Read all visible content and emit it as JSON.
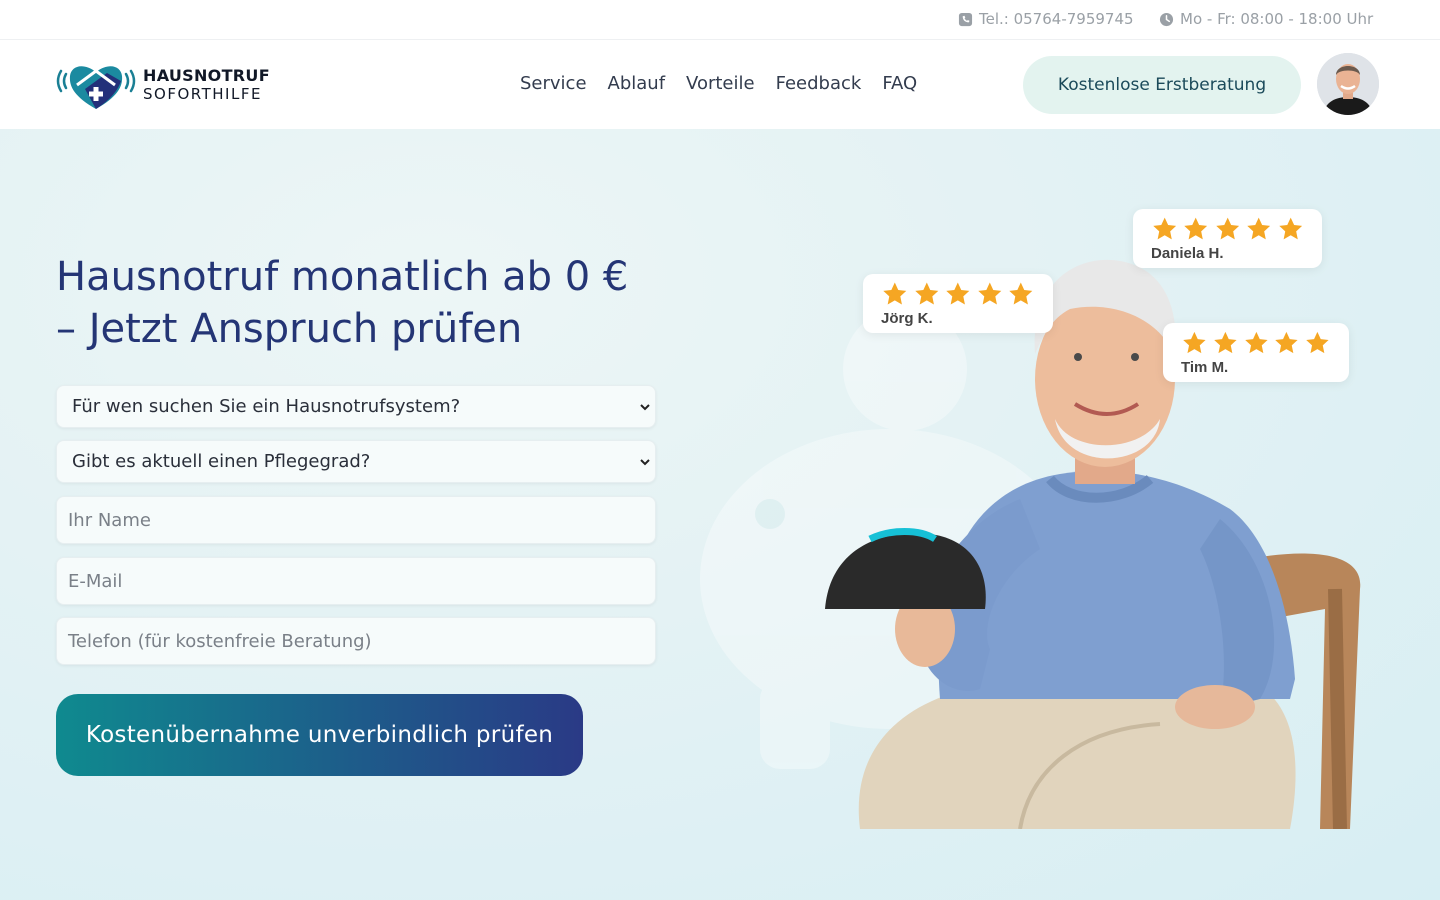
{
  "topbar": {
    "phone": "Tel.: 05764-7959745",
    "hours": "Mo - Fr: 08:00 - 18:00 Uhr"
  },
  "header": {
    "logo_line1": "HAUSNOTRUF",
    "logo_line2": "SOFORTHILFE",
    "nav": [
      "Service",
      "Ablauf",
      "Vorteile",
      "Feedback",
      "FAQ"
    ],
    "cta": "Kostenlose Erstberatung"
  },
  "hero": {
    "headline_line1": "Hausnotruf monatlich ab 0 €",
    "headline_line2": "– Jetzt Anspruch prüfen",
    "select_recipient": "Für wen suchen Sie ein Hausnotrufsystem?",
    "select_care_level": "Gibt es aktuell einen Pflegegrad?",
    "name_placeholder": "Ihr Name",
    "email_placeholder": "E-Mail",
    "phone_placeholder": "Telefon (für kostenfreie Beratung)",
    "submit": "Kostenübernahme unverbindlich prüfen"
  },
  "reviews": [
    {
      "name": "Daniela H.",
      "stars": 5
    },
    {
      "name": "Jörg K.",
      "stars": 5
    },
    {
      "name": "Tim M.",
      "stars": 5
    }
  ],
  "colors": {
    "headline": "#243575",
    "accent_teal": "#0f8a8f",
    "accent_navy": "#2a3a86",
    "cta_bg": "#e3f3ef",
    "star": "#f5a623"
  }
}
